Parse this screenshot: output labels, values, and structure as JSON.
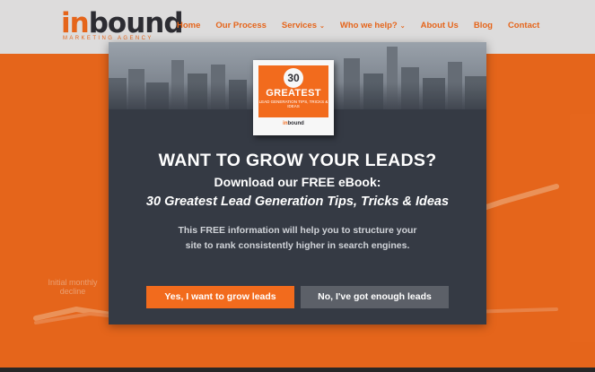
{
  "header": {
    "logo": {
      "prefix": "in",
      "suffix": "bound",
      "tagline": "MARKETING AGENCY"
    },
    "nav": [
      {
        "label": "Home",
        "dropdown": false
      },
      {
        "label": "Our Process",
        "dropdown": false
      },
      {
        "label": "Services",
        "dropdown": true
      },
      {
        "label": "Who we help?",
        "dropdown": true
      },
      {
        "label": "About Us",
        "dropdown": false
      },
      {
        "label": "Blog",
        "dropdown": false
      },
      {
        "label": "Contact",
        "dropdown": false
      }
    ]
  },
  "hero": {
    "note": "Initial monthly decline"
  },
  "modal": {
    "ebook": {
      "number": "30",
      "title": "GREATEST",
      "subtitle": "LEAD GENERATION TIPS, TRICKS & IDEAS",
      "brand_prefix": "in",
      "brand_suffix": "bound"
    },
    "headline": "WANT TO GROW YOUR LEADS?",
    "subheadline": "Download our FREE eBook:",
    "book_title": "30 Greatest Lead Generation Tips, Tricks & Ideas",
    "body": "This FREE information will help you to structure your site to rank consistently higher in search engines.",
    "accept_label": "Yes, I want to grow leads",
    "decline_label": "No, I've got enough leads"
  },
  "colors": {
    "accent": "#f26b1d",
    "modal_bg": "#353a44",
    "decline_button": "#5c6068",
    "header_bg": "#e9e8e8"
  }
}
